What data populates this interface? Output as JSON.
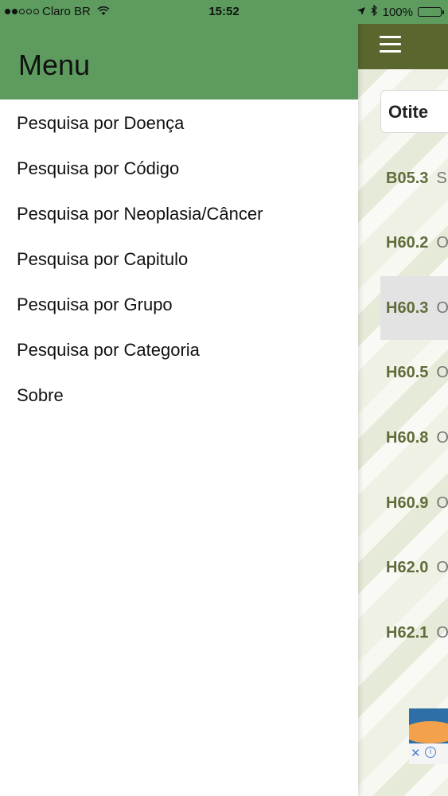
{
  "status_bar": {
    "carrier": "Claro BR",
    "time": "15:52",
    "battery": "100%"
  },
  "drawer": {
    "title": "Menu",
    "items": [
      {
        "label": "Pesquisa por Doença"
      },
      {
        "label": "Pesquisa por Código"
      },
      {
        "label": "Pesquisa por Neoplasia/Câncer"
      },
      {
        "label": "Pesquisa por Capitulo"
      },
      {
        "label": "Pesquisa por Grupo"
      },
      {
        "label": "Pesquisa por Categoria"
      },
      {
        "label": "Sobre"
      }
    ]
  },
  "main": {
    "search_value": "Otite",
    "codes": [
      {
        "code": "B05.3",
        "tail": "S"
      },
      {
        "code": "H60.2",
        "tail": "O"
      },
      {
        "code": "H60.3",
        "tail": "O"
      },
      {
        "code": "H60.5",
        "tail": "O"
      },
      {
        "code": "H60.8",
        "tail": "O"
      },
      {
        "code": "H60.9",
        "tail": "O"
      },
      {
        "code": "H62.0",
        "tail": "O"
      },
      {
        "code": "H62.1",
        "tail": "O"
      }
    ]
  },
  "colors": {
    "drawer_header": "#5d9c5e",
    "app_header": "#59662e",
    "code_text": "#5f6d3a"
  }
}
